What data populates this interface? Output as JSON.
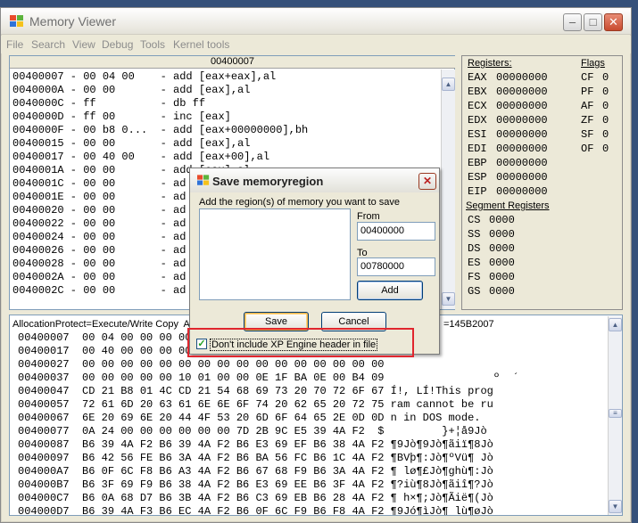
{
  "window": {
    "title": "Memory Viewer"
  },
  "menu": [
    "File",
    "Search",
    "View",
    "Debug",
    "Tools",
    "Kernel tools"
  ],
  "disassembler": {
    "header": "00400007",
    "rows": [
      "00400007 - 00 04 00    - add [eax+eax],al",
      "0040000A - 00 00       - add [eax],al",
      "0040000C - ff          - db ff",
      "0040000D - ff 00       - inc [eax]",
      "0040000F - 00 b8 0...  - add [eax+00000000],bh",
      "00400015 - 00 00       - add [eax],al",
      "00400017 - 00 40 00    - add [eax+00],al",
      "0040001A - 00 00       - add [eax],al",
      "0040001C - 00 00       - ad",
      "0040001E - 00 00       - ad",
      "00400020 - 00 00       - ad",
      "00400022 - 00 00       - ad",
      "00400024 - 00 00       - ad",
      "00400026 - 00 00       - ad",
      "00400028 - 00 00       - ad",
      "0040002A - 00 00       - ad",
      "0040002C - 00 00       - ad"
    ]
  },
  "registers": {
    "title": "Registers:",
    "flags_title": "Flags",
    "items": [
      {
        "name": "EAX",
        "value": "00000000"
      },
      {
        "name": "EBX",
        "value": "00000000"
      },
      {
        "name": "ECX",
        "value": "00000000"
      },
      {
        "name": "EDX",
        "value": "00000000"
      },
      {
        "name": "ESI",
        "value": "00000000"
      },
      {
        "name": "EDI",
        "value": "00000000"
      },
      {
        "name": "EBP",
        "value": "00000000"
      },
      {
        "name": "ESP",
        "value": "00000000"
      },
      {
        "name": "EIP",
        "value": "00000000"
      }
    ],
    "flags": [
      {
        "name": "CF",
        "value": "0"
      },
      {
        "name": "PF",
        "value": "0"
      },
      {
        "name": "AF",
        "value": "0"
      },
      {
        "name": "ZF",
        "value": "0"
      },
      {
        "name": "SF",
        "value": "0"
      },
      {
        "name": "OF",
        "value": "0"
      }
    ],
    "segment_title": "Segment Registers",
    "segments": [
      {
        "name": "CS",
        "value": "0000"
      },
      {
        "name": "SS",
        "value": "0000"
      },
      {
        "name": "DS",
        "value": "0000"
      },
      {
        "name": "ES",
        "value": "0000"
      },
      {
        "name": "FS",
        "value": "0000"
      },
      {
        "name": "GS",
        "value": "0000"
      }
    ]
  },
  "hexview": {
    "info_left": "AllocationProtect=Execute/Write Copy  All",
    "info_right": "=145B2007",
    "rows": [
      "00400007  00 04 00 00 00 00 00 FF",
      "00400017  00 40 00 00 00 00 00 00",
      "00400027  00 00 00 00 00 00 00 00 00 00 00 00 00 00 00 00",
      "00400037  00 00 00 00 00 10 01 00 00 0E 1F BA 0E 00 B4 09                 º  ´",
      "00400047  CD 21 B8 01 4C CD 21 54 68 69 73 20 70 72 6F 67 Í!, LÍ!This prog",
      "00400057  72 61 6D 20 63 61 6E 6E 6F 74 20 62 65 20 72 75 ram cannot be ru",
      "00400067  6E 20 69 6E 20 44 4F 53 20 6D 6F 64 65 2E 0D 0D n in DOS mode.",
      "00400077  0A 24 00 00 00 00 00 00 7D 2B 9C E5 39 4A F2  $         }+¦å9Jò",
      "00400087  B6 39 4A F2 B6 39 4A F2 B6 E3 69 EF B6 38 4A F2 ¶9Jò¶9Jò¶ãiï¶8Jò",
      "00400097  B6 42 56 FE B6 3A 4A F2 B6 BA 56 FC B6 1C 4A F2 ¶BVþ¶:Jò¶ºVü¶ Jò",
      "004000A7  B6 0F 6C F8 B6 A3 4A F2 B6 67 68 F9 B6 3A 4A F2 ¶ lø¶£Jò¶ghù¶:Jò",
      "004000B7  B6 3F 69 F9 B6 38 4A F2 B6 E3 69 EE B6 3F 4A F2 ¶?iù¶8Jò¶ãiî¶?Jò",
      "004000C7  B6 0A 68 D7 B6 3B 4A F2 B6 C3 69 EB B6 28 4A F2 ¶ h×¶;Jò¶Ãië¶(Jò",
      "004000D7  B6 39 4A F3 B6 EC 4A F2 B6 0F 6C F9 B6 F8 4A F2 ¶9Jó¶ìJò¶ lù¶øJò",
      "004000E7  B6 FE 4C F4 B6 39 4A F2 B6 C6 6A F6 B6 31 4A F2 ¶þLô¶9Jò¶Æjö¶1Jò",
      "004000F7  B6 52 69 63 68 38 4A F2 B6 00 00 00 00 00 00 00 ¶Rich8Jò¶"
    ]
  },
  "dialog": {
    "title": "Save memoryregion",
    "instruction": "Add the region(s) of memory you want to save",
    "from_label": "From",
    "from_value": "00400000",
    "to_label": "To",
    "to_value": "00780000",
    "add_label": "Add",
    "save_label": "Save",
    "cancel_label": "Cancel",
    "checkbox_label": "Don't include XP Engine header in file",
    "checkbox_checked": true
  }
}
